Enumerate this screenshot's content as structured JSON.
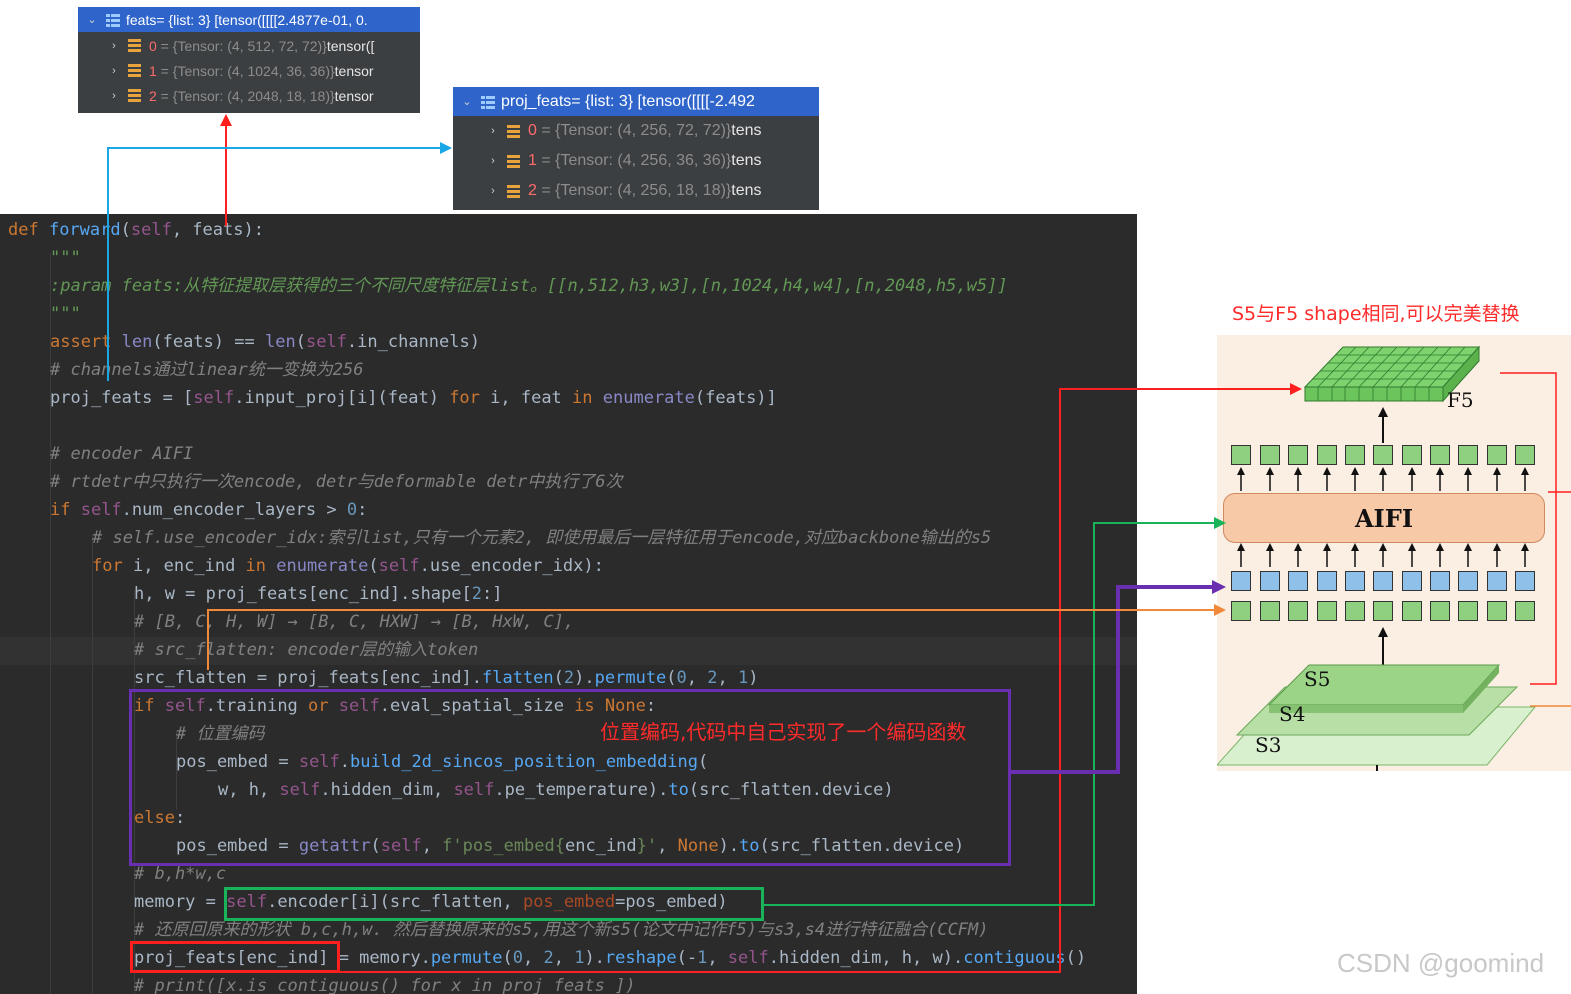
{
  "feats_panel": {
    "header": {
      "name": "feats",
      "rest": " = {list: 3} [tensor([[[[2.4877e-01, 0."
    },
    "items": [
      {
        "index": "0",
        "type": "{Tensor: (4, 512, 72, 72)}",
        "value": " tensor(["
      },
      {
        "index": "1",
        "type": "{Tensor: (4, 1024, 36, 36)}",
        "value": " tensor"
      },
      {
        "index": "2",
        "type": "{Tensor: (4, 2048, 18, 18)}",
        "value": " tensor"
      }
    ]
  },
  "proj_panel": {
    "header": {
      "name": "proj_feats",
      "rest": " = {list: 3} [tensor([[[[-2.492"
    },
    "items": [
      {
        "index": "0",
        "type": "{Tensor: (4, 256, 72, 72)}",
        "value": " tens"
      },
      {
        "index": "1",
        "type": "{Tensor: (4, 256, 36, 36)}",
        "value": " tens"
      },
      {
        "index": "2",
        "type": "{Tensor: (4, 256, 18, 18)}",
        "value": " tens"
      }
    ]
  },
  "code": {
    "l1": [
      "def ",
      "forward",
      "(",
      "self",
      ", feats):"
    ],
    "l2": "\"\"\"",
    "l3": ":param feats:从特征提取层获得的三个不同尺度特征层list。[[n,512,h3,w3],[n,1024,h4,w4],[n,2048,h5,w5]]",
    "l4": "\"\"\"",
    "l5": [
      "assert ",
      "len",
      "(feats) ",
      "==",
      " ",
      "len",
      "(",
      "self",
      ".in_channels)"
    ],
    "l6": "# channels通过linear统一变换为256",
    "l7": [
      "proj_feats = [",
      "self",
      ".input_proj[i](feat) ",
      "for",
      " i, feat ",
      "in",
      " ",
      "enumerate",
      "(feats)]"
    ],
    "l8": "# encoder AIFI",
    "l9": "# rtdetr中只执行一次encode, detr与deformable detr中执行了6次",
    "l10": [
      "if ",
      "self",
      ".num_encoder_layers > ",
      "0",
      ":"
    ],
    "l11": "# self.use_encoder_idx:索引list,只有一个元素2, 即使用最后一层特征用于encode,对应backbone输出的s5",
    "l12": [
      "for",
      " i, enc_ind ",
      "in",
      " ",
      "enumerate",
      "(",
      "self",
      ".use_encoder_idx):"
    ],
    "l13": [
      "h, w = proj_feats[enc_ind].shape[",
      "2",
      ":]"
    ],
    "l14": "# [B, C, H, W] → [B, C, HXW] → [B, HxW, C],",
    "l15": "# src_flatten: encoder层的输入token",
    "l16": [
      "src_flatten = proj_feats[enc_ind].",
      "flatten",
      "(",
      "2",
      ").",
      "permute",
      "(",
      "0",
      ", ",
      "2",
      ", ",
      "1",
      ")"
    ],
    "l17": [
      "if ",
      "self",
      ".training ",
      "or",
      " ",
      "self",
      ".eval_spatial_size ",
      "is",
      " ",
      "None",
      ":"
    ],
    "l18": "# 位置编码",
    "l19": [
      "pos_embed = ",
      "self",
      ".",
      "build_2d_sincos_position_embedding",
      "("
    ],
    "l20": [
      "w, h, ",
      "self",
      ".hidden_dim, ",
      "self",
      ".pe_temperature).",
      "to",
      "(src_flatten.device)"
    ],
    "l21": [
      "else",
      ":"
    ],
    "l22": [
      "pos_embed = ",
      "getattr",
      "(",
      "self",
      ", ",
      "f'pos_embed{",
      "enc_ind",
      "}'",
      ", ",
      "None",
      ").",
      "to",
      "(src_flatten.device)"
    ],
    "l23": "# b,h*w,c",
    "l24": [
      "memory = ",
      "self",
      ".encoder[i](src_flatten, ",
      "pos_embed",
      "=pos_embed)"
    ],
    "l25": "# 还原回原来的形状 b,c,h,w. 然后替换原来的s5,用这个新s5(论文中记作f5)与s3,s4进行特征融合(CCFM)",
    "l26": [
      "proj_feats[enc_ind] = memory.",
      "permute",
      "(",
      "0",
      ", ",
      "2",
      ", ",
      "1",
      ").",
      "reshape",
      "(-",
      "1",
      ", ",
      "self",
      ".hidden_dim, h, w).",
      "contiguous",
      "()"
    ],
    "l27": "# print([x.is_contiguous() for x in proj_feats ])"
  },
  "annotations": {
    "pos_note": "位置编码,代码中自己实现了一个编码函数",
    "shape_note": "S5与F5 shape相同,可以完美替换"
  },
  "figure": {
    "f5_label": "F5",
    "aifi_label": "AIFI",
    "s5_label": "S5",
    "s4_label": "S4",
    "s3_label": "S3"
  },
  "watermark": "CSDN @goomind",
  "colors": {
    "red": "#ff1f1f",
    "blue": "#1aa7e6",
    "green": "#19b35a",
    "purple": "#6a2fb0",
    "orange": "#f08a3a"
  }
}
